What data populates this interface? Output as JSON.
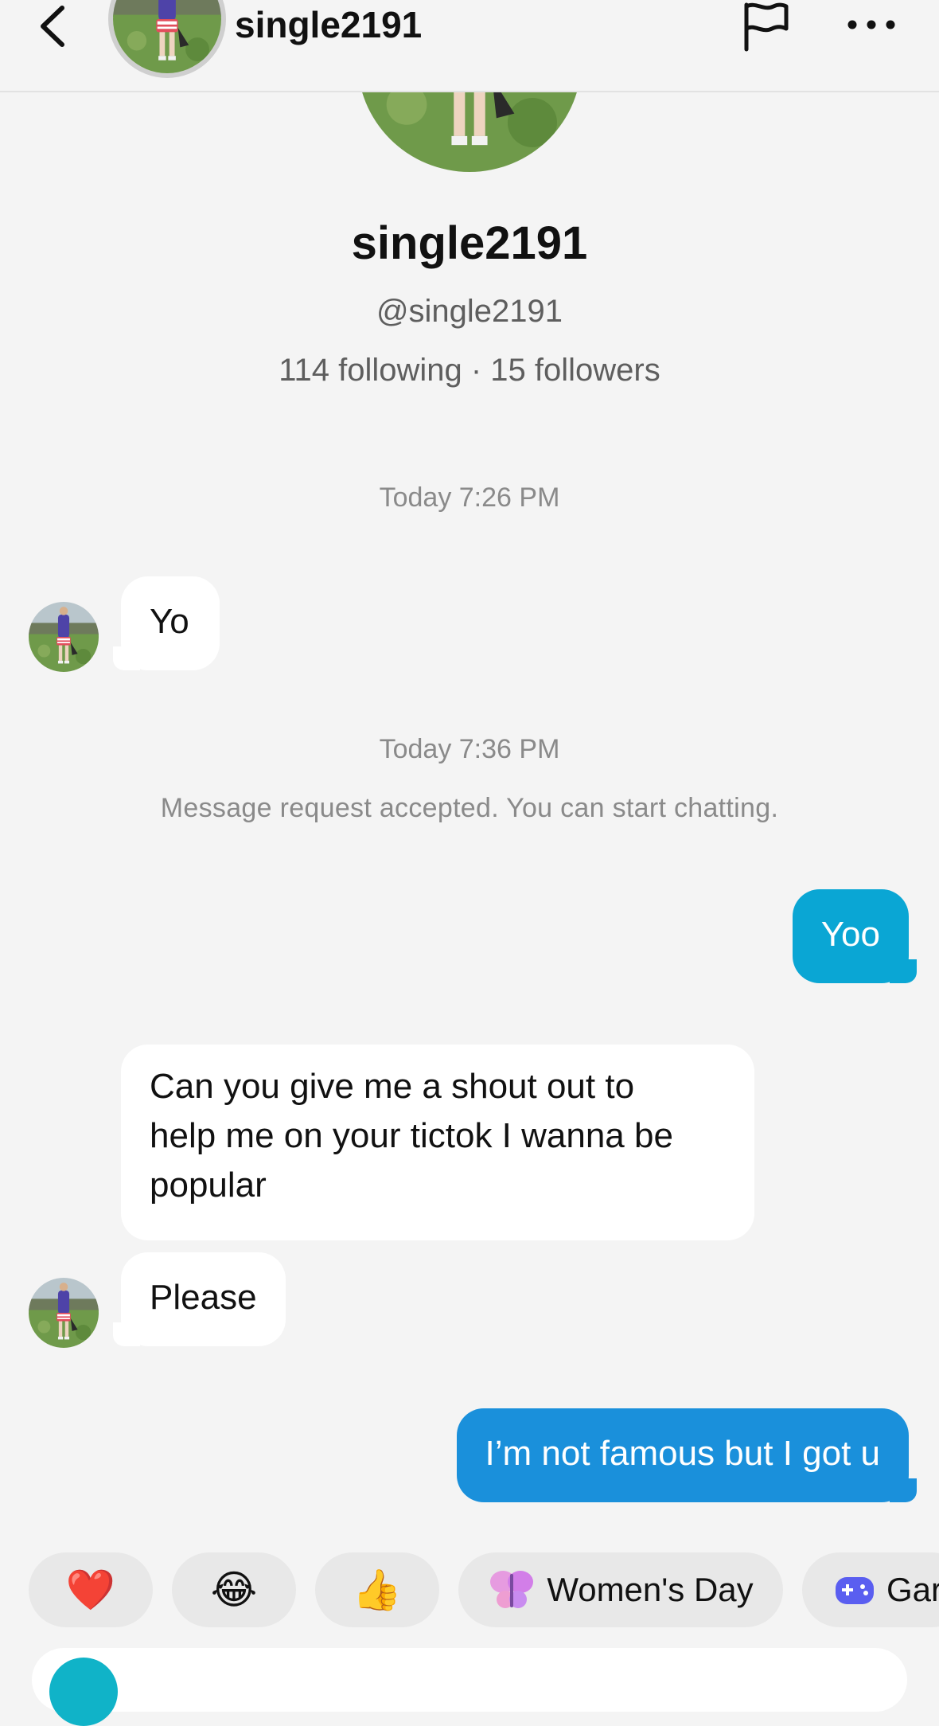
{
  "header": {
    "username": "single2191",
    "back_icon": "chevron-left-icon",
    "flag_icon": "flag-icon",
    "more_icon": "more-horizontal-icon"
  },
  "profile": {
    "display_name": "single2191",
    "handle": "@single2191",
    "stats": "114 following · 15 followers"
  },
  "conversation": {
    "timestamp_1": "Today 7:26 PM",
    "message_1": "Yo",
    "timestamp_2": "Today 7:36 PM",
    "system_message": "Message request accepted. You can start chatting.",
    "message_2": "Yoo",
    "message_3_lines": [
      "Can you give me a shout out to",
      "help me on your tictok I wanna be",
      "popular"
    ],
    "message_4": "Please",
    "message_5": "I’m not famous but I got u"
  },
  "quick_reactions": {
    "heart": "❤️",
    "laugh": "😂",
    "thumbs_up": "👍",
    "womens_day_icon": "butterfly-icon",
    "womens_day_label": "Women's Day",
    "games_icon": "gamepad-icon",
    "games_label": "Gar"
  },
  "colors": {
    "incoming_bubble": "#ffffff",
    "outgoing_teal": "#0aa6d4",
    "outgoing_blue": "#1a90db",
    "background": "#f4f4f4"
  }
}
